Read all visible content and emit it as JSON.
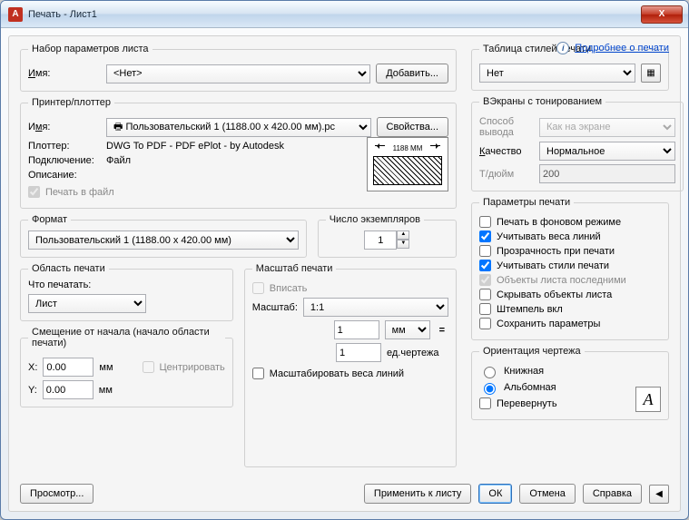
{
  "window": {
    "title": "Печать - Лист1"
  },
  "help": {
    "link": "Подробнее о печати"
  },
  "pageSetup": {
    "legend": "Набор параметров листа",
    "nameLabel": "Имя:",
    "nameValue": "<Нет>",
    "addBtn": "Добавить..."
  },
  "printer": {
    "legend": "Принтер/плоттер",
    "nameLabel": "Имя:",
    "nameValue": "Пользовательский 1 (1188.00 x 420.00 мм).pc",
    "propsBtn": "Свойства...",
    "plotterLabel": "Плоттер:",
    "plotterValue": "DWG To PDF - PDF ePlot - by Autodesk",
    "connLabel": "Подключение:",
    "connValue": "Файл",
    "descLabel": "Описание:",
    "plotToFile": "Печать в файл",
    "previewDim": "1188 MM"
  },
  "paper": {
    "legend": "Формат",
    "value": "Пользовательский 1 (1188.00 x 420.00 мм)"
  },
  "copies": {
    "legend": "Число экземпляров",
    "value": "1"
  },
  "area": {
    "legend": "Область печати",
    "whatLabel": "Что печатать:",
    "value": "Лист"
  },
  "scale": {
    "legend": "Масштаб печати",
    "fit": "Вписать",
    "scaleLabel": "Масштаб:",
    "scaleValue": "1:1",
    "num": "1",
    "unit": "мм",
    "den": "1",
    "denUnit": "ед.чертежа",
    "scaleLW": "Масштабировать веса линий"
  },
  "offset": {
    "legend": "Смещение от начала (начало области печати)",
    "xl": "X:",
    "xv": "0.00",
    "xu": "мм",
    "yl": "Y:",
    "yv": "0.00",
    "yu": "мм",
    "center": "Центрировать"
  },
  "styleTable": {
    "legend": "Таблица стилей печати",
    "value": "Нет"
  },
  "shaded": {
    "legend": "ВЭкраны с тонированием",
    "modeLabel": "Способ вывода",
    "modeValue": "Как на экране",
    "qualLabel": "Качество",
    "qualValue": "Нормальное",
    "dpiLabel": "Т/дюйм",
    "dpiValue": "200"
  },
  "options": {
    "legend": "Параметры печати",
    "bg": "Печать в фоновом режиме",
    "lw": "Учитывать веса линий",
    "tr": "Прозрачность при печати",
    "st": "Учитывать стили печати",
    "ps": "Объекты листа последними",
    "hide": "Скрывать объекты листа",
    "stamp": "Штемпель вкл",
    "save": "Сохранить параметры"
  },
  "orient": {
    "legend": "Ориентация чертежа",
    "portrait": "Книжная",
    "landscape": "Альбомная",
    "upside": "Перевернуть",
    "iconLetter": "A"
  },
  "footer": {
    "preview": "Просмотр...",
    "apply": "Применить к листу",
    "ok": "ОК",
    "cancel": "Отмена",
    "help": "Справка"
  }
}
